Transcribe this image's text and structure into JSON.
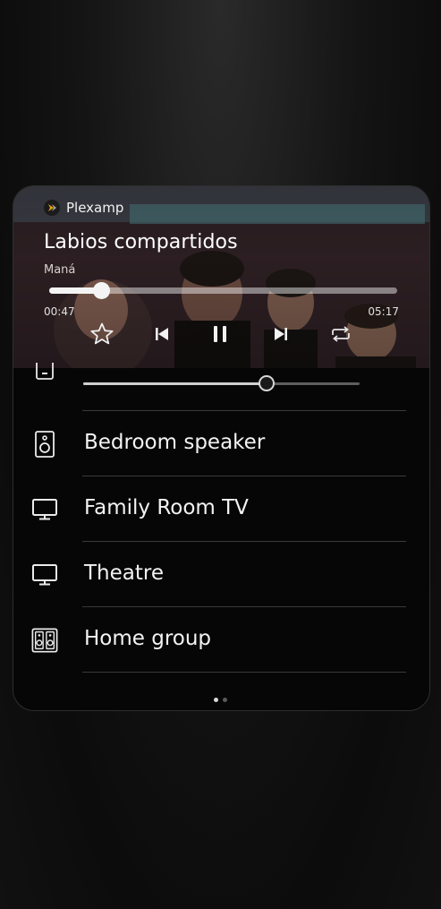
{
  "app": {
    "name": "Plexamp"
  },
  "now_playing": {
    "title": "Labios compartidos",
    "artist": "Maná",
    "elapsed": "00:47",
    "duration": "05:17",
    "progress": 0.148
  },
  "controls": {
    "favorite_icon": "star-icon",
    "previous_icon": "skip-previous-icon",
    "play_pause_icon": "pause-icon",
    "next_icon": "skip-next-icon",
    "repeat_icon": "repeat-icon"
  },
  "output": {
    "volume": 0.66,
    "devices": [
      {
        "label": "Bedroom speaker",
        "icon": "speaker-icon"
      },
      {
        "label": "Family Room TV",
        "icon": "tv-icon"
      },
      {
        "label": "Theatre",
        "icon": "tv-icon"
      },
      {
        "label": "Home group",
        "icon": "speaker-group-icon"
      }
    ]
  },
  "pager": {
    "pages": 2,
    "current": 1
  },
  "colors": {
    "background": "#111111",
    "panel": "#060606",
    "accent": "#f4f4f4",
    "logo": "#e5a00d"
  }
}
